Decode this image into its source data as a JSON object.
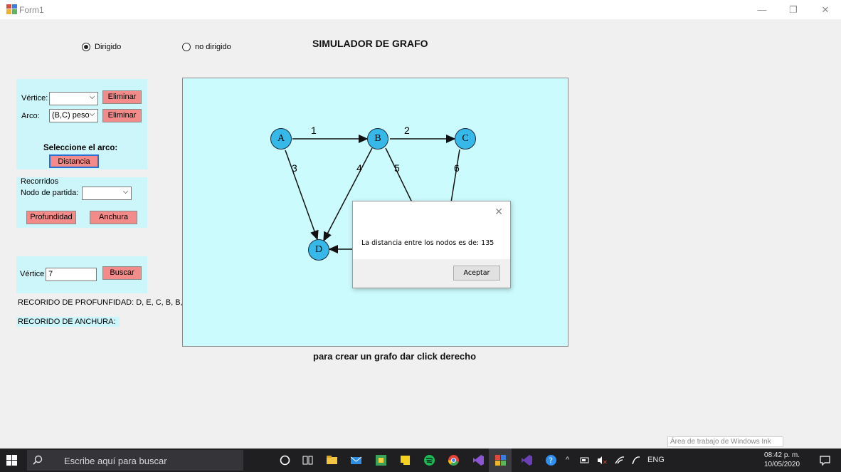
{
  "window": {
    "title": "Form1"
  },
  "mode": {
    "directed_label": "Dirigido",
    "undirected_label": "no dirigido",
    "selected": "Dirigido"
  },
  "main_title": "SIMULADOR DE GRAFO",
  "edit_panel": {
    "vertex_label": "Vértice:",
    "vertex_value": "",
    "arc_label": "Arco:",
    "arc_value": "(B,C) peso",
    "delete_label": "Eliminar",
    "select_arc_label": "Seleccione el arco:",
    "distance_label": "Distancia"
  },
  "traversal_panel": {
    "group_label": "Recorridos",
    "start_node_label": "Nodo de partida:",
    "start_node_value": "",
    "depth_label": "Profundidad",
    "breadth_label": "Anchura"
  },
  "search_panel": {
    "vertex_label": "Vértice",
    "vertex_value": "7",
    "search_label": "Buscar"
  },
  "results": {
    "depth": "RECORIDO DE PROFUNFIDAD: D, E, C, B, B, B, A, A,",
    "breadth": "RECORIDO DE ANCHURA:"
  },
  "graph": {
    "nodes": [
      "A",
      "B",
      "C",
      "D"
    ],
    "edge_labels": [
      "1",
      "2",
      "3",
      "4",
      "5",
      "6"
    ]
  },
  "dialog": {
    "message": "La distancia entre los nodos es de: 135",
    "ok_label": "Aceptar"
  },
  "footer_hint": "para crear un grafo dar click derecho",
  "watermark": "Área de trabajo de Windows Ink",
  "taskbar": {
    "search_placeholder": "Escribe aquí para buscar",
    "language": "ENG",
    "time": "08:42 p. m.",
    "date": "10/05/2020"
  },
  "colors": {
    "canvas_bg": "#ccfbfd",
    "node_fill": "#36b9e8",
    "panel_bg": "#ccf6fa",
    "button_red": "#f38b8b"
  }
}
